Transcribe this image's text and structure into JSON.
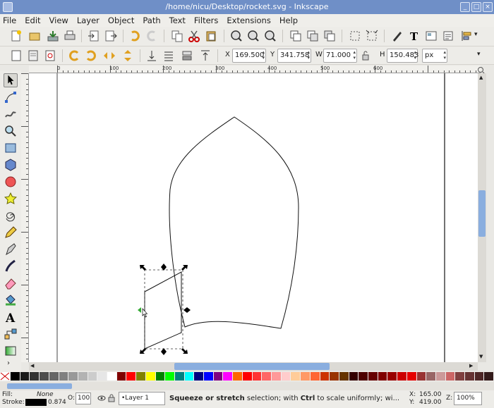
{
  "window": {
    "title": "/home/nicu/Desktop/rocket.svg - Inkscape"
  },
  "menu": [
    "File",
    "Edit",
    "View",
    "Layer",
    "Object",
    "Path",
    "Text",
    "Filters",
    "Extensions",
    "Help"
  ],
  "toolbar2": {
    "x_label": "X",
    "x_value": "169.500",
    "y_label": "Y",
    "y_value": "341.758",
    "w_label": "W",
    "w_value": "71.000",
    "h_label": "H",
    "h_value": "150.483",
    "unit": "px"
  },
  "ruler": {
    "h_labels": [
      "0",
      "100",
      "200",
      "300",
      "400",
      "500",
      "600"
    ]
  },
  "colors": {
    "title_bar": "#6f8fc7",
    "palette": [
      "#000000",
      "#1a1a1a",
      "#333333",
      "#4d4d4d",
      "#666666",
      "#808080",
      "#999999",
      "#b3b3b3",
      "#cccccc",
      "#e6e6e6",
      "#ffffff",
      "#800000",
      "#ff0000",
      "#808000",
      "#ffff00",
      "#008000",
      "#00ff00",
      "#008080",
      "#00ffff",
      "#000080",
      "#0000ff",
      "#800080",
      "#ff00ff",
      "#ff6600",
      "#ff0000",
      "#ff3333",
      "#ff6666",
      "#ff9999",
      "#ffcccc",
      "#ffcc99",
      "#ff9966",
      "#ff6633",
      "#cc3300",
      "#993300",
      "#663300",
      "#330000",
      "#4d0000",
      "#660000",
      "#800000",
      "#990000",
      "#cc0000",
      "#e60000",
      "#993333",
      "#996666",
      "#cc9999",
      "#cc6666",
      "#804040",
      "#663333",
      "#4d2626",
      "#331a1a"
    ]
  },
  "status": {
    "fill_label": "Fill:",
    "fill_value": "None",
    "stroke_label": "Stroke:",
    "stroke_width": "0.874",
    "opacity_label": "O:",
    "opacity_value": "100",
    "layer": "•Layer 1",
    "message_bold1": "Squeeze or stretch",
    "message_mid": " selection; with ",
    "message_bold2": "Ctrl",
    "message_end": " to scale uniformly; wi...",
    "x_label": "X:",
    "x_value": "165.00",
    "y_label": "Y:",
    "y_value": "419.00",
    "zoom_label": "Z:",
    "zoom_value": "100%"
  }
}
